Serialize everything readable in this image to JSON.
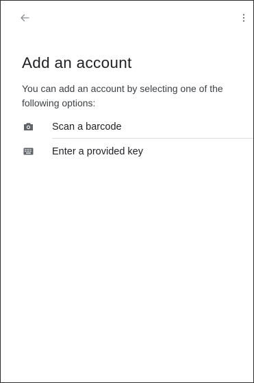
{
  "header": {
    "back_icon": "arrow-back-icon",
    "overflow_icon": "more-vert-icon"
  },
  "content": {
    "title": "Add an account",
    "description": "You can add an account by selecting one of the following options:"
  },
  "options": [
    {
      "label": "Scan a barcode",
      "icon": "camera-icon"
    },
    {
      "label": "Enter a provided key",
      "icon": "keyboard-icon"
    }
  ],
  "colors": {
    "text_primary": "#202124",
    "text_secondary": "#3c4043",
    "icon": "#5f6368",
    "divider": "#dadce0",
    "frame_border": "#2b2b2b"
  }
}
